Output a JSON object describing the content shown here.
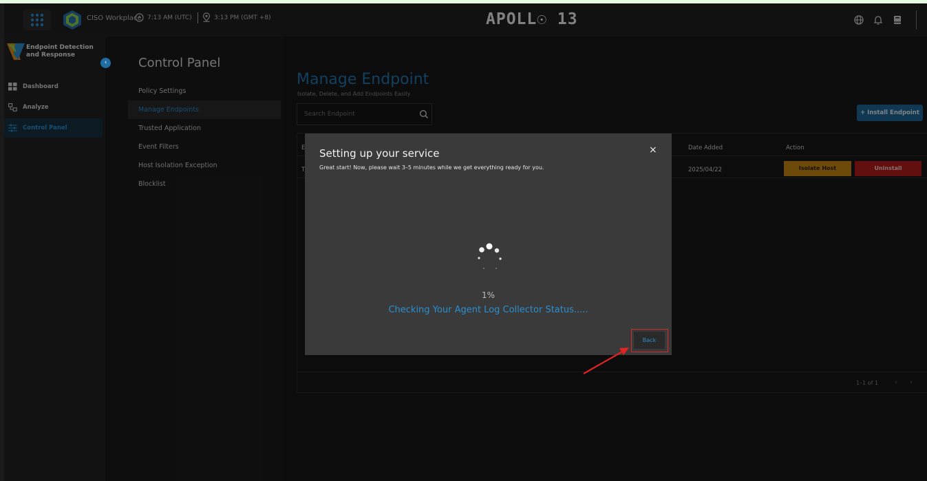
{
  "header": {
    "workplace": "CISO Workplace",
    "time_utc": "7:13 AM (UTC)",
    "time_gmt": "3:13 PM (GMT +8)",
    "brand": "APOLL☉ 13",
    "icons": [
      "apps-grid-icon",
      "globe-icon",
      "bell-icon",
      "book-icon"
    ]
  },
  "sidebar": {
    "title": "Endpoint Detection and Response",
    "collapse_glyph": "‹",
    "items": [
      {
        "label": "Dashboard",
        "icon": "dashboard-icon"
      },
      {
        "label": "Analyze",
        "icon": "analyze-icon"
      },
      {
        "label": "Control Panel",
        "icon": "sliders-icon"
      }
    ]
  },
  "control_panel": {
    "title": "Control Panel",
    "items": [
      {
        "label": "Policy Settings"
      },
      {
        "label": "Manage Endpoints"
      },
      {
        "label": "Trusted Application"
      },
      {
        "label": "Event Filters"
      },
      {
        "label": "Host Isolation Exception"
      },
      {
        "label": "Blocklist"
      }
    ]
  },
  "main": {
    "title": "Manage Endpoint",
    "subtitle": "Isolate, Delete, and Add Endpoints Easily",
    "search_placeholder": "Search Endpoint",
    "install_button": "+ Install Endpoint",
    "table": {
      "headers": {
        "first": "E",
        "date": "Date Added",
        "action": "Action"
      },
      "row": {
        "first": "T",
        "date": "2025/04/22",
        "isolate": "Isolate Host",
        "uninstall": "Uninstall"
      },
      "pager": "1–1 of 1",
      "prev": "‹",
      "next": "›"
    }
  },
  "modal": {
    "title": "Setting up your service",
    "subtitle": "Great start! Now, please wait 3–5 minutes while we get everything ready for you.",
    "close": "×",
    "progress": "1%",
    "status": "Checking Your Agent Log Collector Status.....",
    "back_button": "Back"
  },
  "colors": {
    "accent": "#2c8fd0",
    "isolate": "#c98813",
    "uninstall": "#b31c1c",
    "highlight": "#d42a2a"
  }
}
